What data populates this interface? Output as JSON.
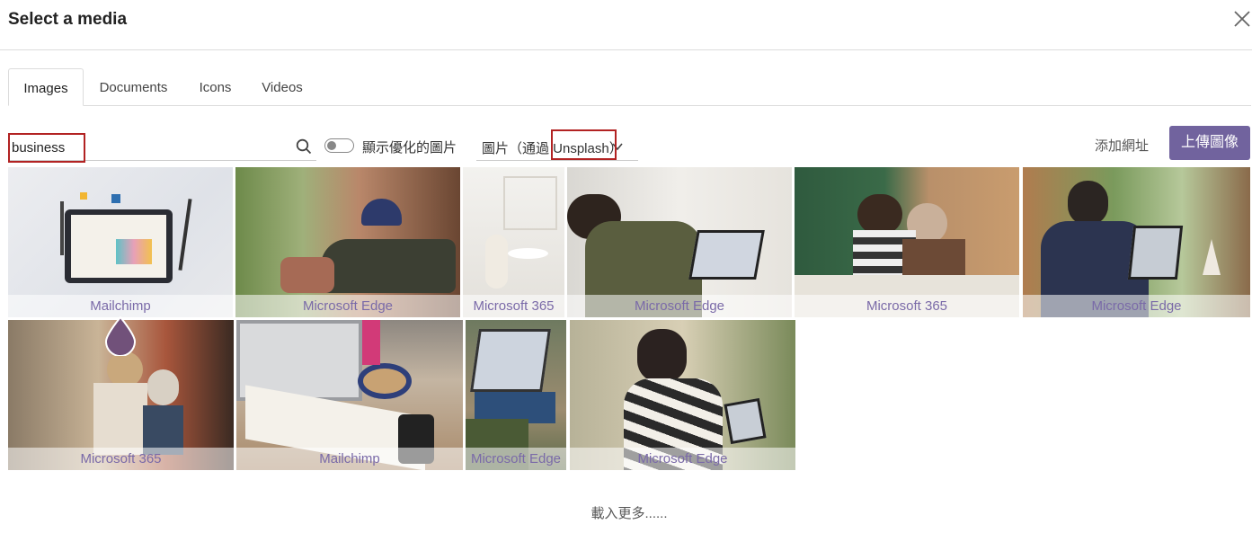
{
  "dialog": {
    "title": "Select a media"
  },
  "tabs": [
    {
      "label": "Images",
      "active": true
    },
    {
      "label": "Documents",
      "active": false
    },
    {
      "label": "Icons",
      "active": false
    },
    {
      "label": "Videos",
      "active": false
    }
  ],
  "toolbar": {
    "search_value": "business",
    "search_icon": "search-icon",
    "toggle_label": "顯示優化的圖片",
    "toggle_on": false,
    "source_select": "圖片（通過 Unsplash）",
    "add_url": "添加網址",
    "upload": "上傳圖像"
  },
  "images": [
    {
      "caption": "Mailchimp"
    },
    {
      "caption": "Microsoft Edge"
    },
    {
      "caption": "Microsoft 365"
    },
    {
      "caption": "Microsoft Edge"
    },
    {
      "caption": "Microsoft 365"
    },
    {
      "caption": "Microsoft Edge"
    },
    {
      "caption": "Microsoft 365"
    },
    {
      "caption": "Mailchimp"
    },
    {
      "caption": "Microsoft Edge"
    },
    {
      "caption": "Microsoft Edge"
    }
  ],
  "load_more": "載入更多......",
  "colors": {
    "accent": "#71639e",
    "caption": "#7a6aa8",
    "highlight": "#b22222"
  }
}
